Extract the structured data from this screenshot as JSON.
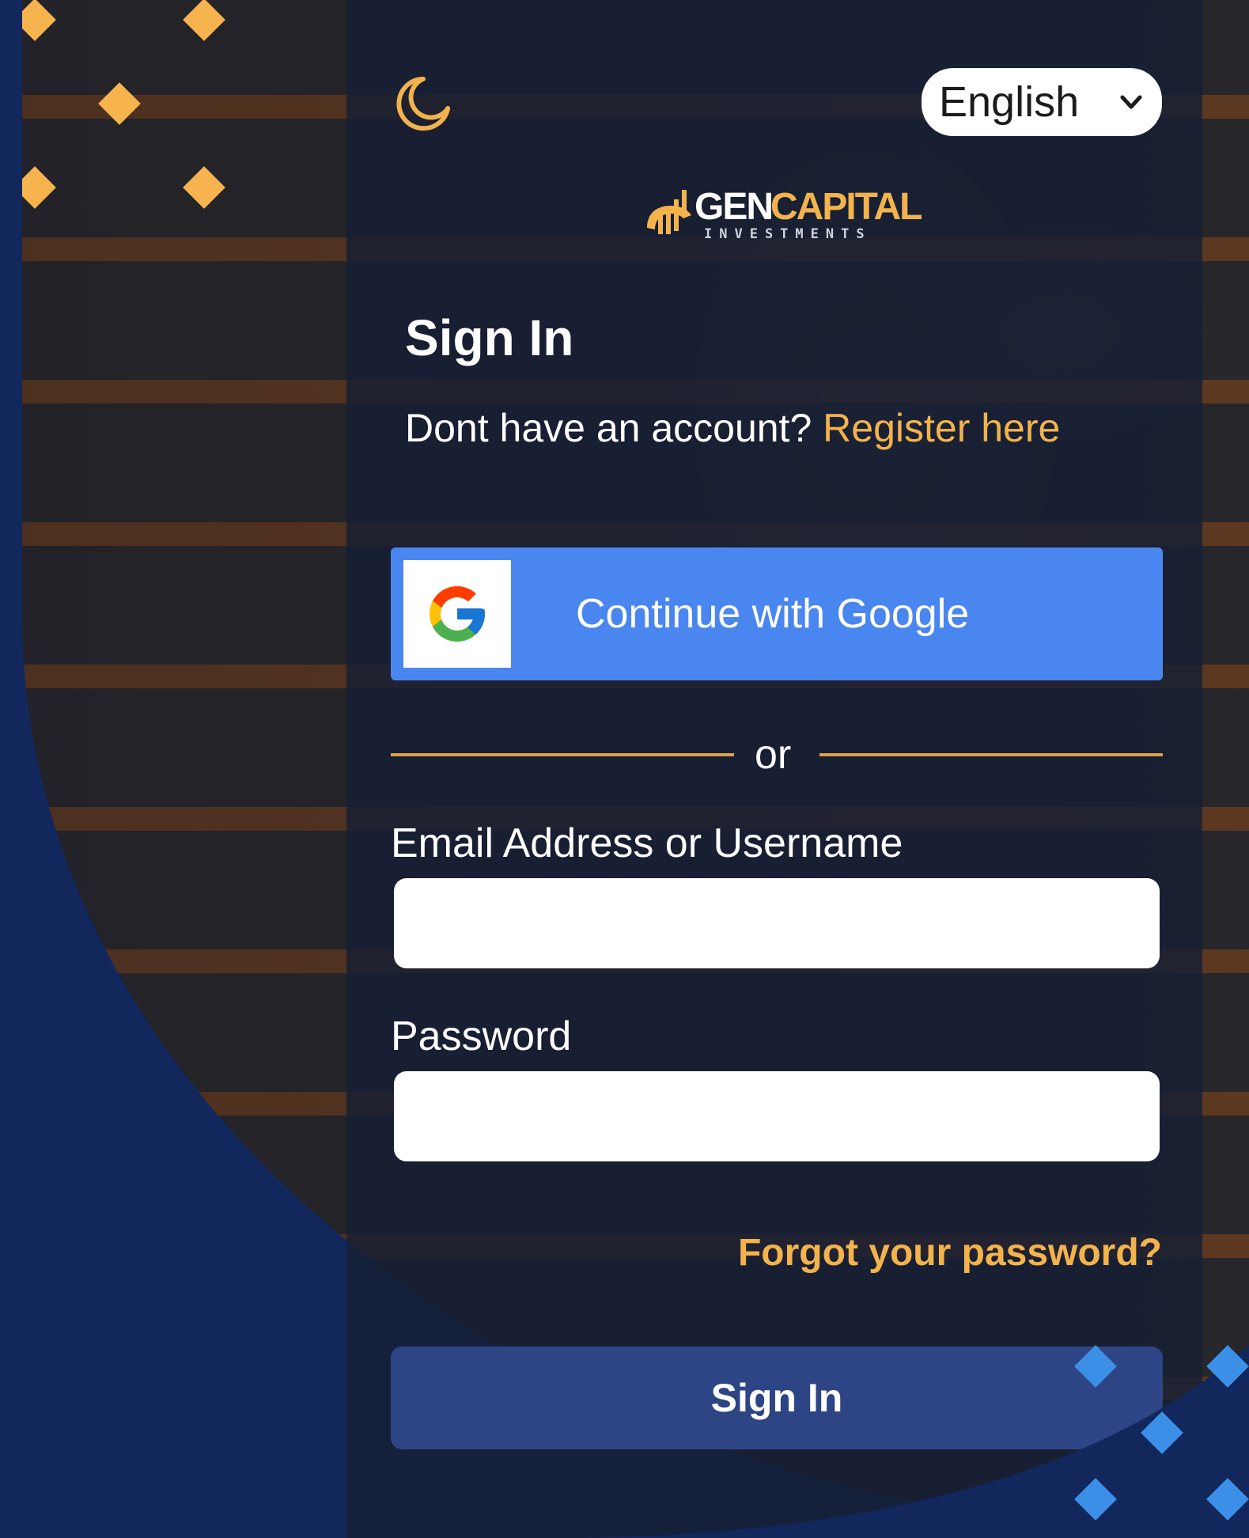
{
  "header": {
    "theme_icon": "moon-icon",
    "language": {
      "selected": "English"
    }
  },
  "logo": {
    "brand_part1": "GEN",
    "brand_part2": "CAPITAL",
    "tagline": "INVESTMENTS"
  },
  "form": {
    "title": "Sign In",
    "register_prompt": "Dont have an account?",
    "register_link": "Register here",
    "google_button": "Continue with Google",
    "divider_text": "or",
    "email_label": "Email Address or Username",
    "email_value": "",
    "password_label": "Password",
    "password_value": "",
    "forgot_link": "Forgot your password?",
    "submit_label": "Sign In"
  },
  "colors": {
    "accent": "#f3b34c",
    "google_blue": "#4a86f0",
    "submit": "#2d4584",
    "page_bg": "#12275c"
  }
}
